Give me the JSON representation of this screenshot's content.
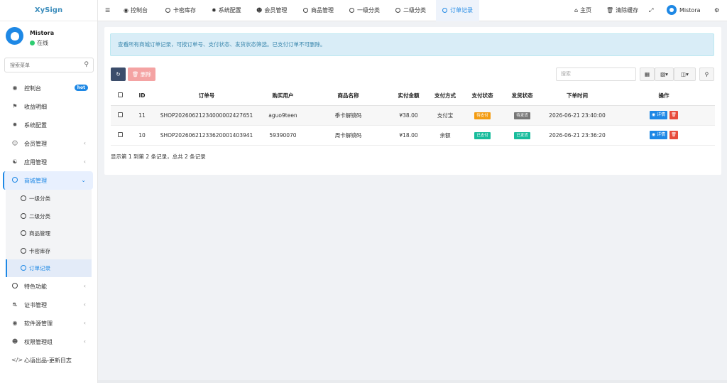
{
  "app": {
    "logo": "XySign"
  },
  "user": {
    "name": "Mistora",
    "status": "在线"
  },
  "sidebar": {
    "search_placeholder": "搜索菜单",
    "items": [
      {
        "label": "控制台",
        "icon": "dashboard-icon",
        "badge": "hot"
      },
      {
        "label": "收益明细",
        "icon": "flag-icon"
      },
      {
        "label": "系统配置",
        "icon": "gear-icon"
      },
      {
        "label": "会员管理",
        "icon": "user-circle-icon"
      },
      {
        "label": "应用管理",
        "icon": "cart-icon"
      },
      {
        "label": "商城管理",
        "icon": "circle-icon",
        "expanded": true
      },
      {
        "label": "特色功能",
        "icon": "circle-icon"
      },
      {
        "label": "证书管理",
        "icon": "car-icon"
      },
      {
        "label": "软件源管理",
        "icon": "dashboard-icon"
      },
      {
        "label": "权限管理组",
        "icon": "group-icon"
      },
      {
        "label": "心语出品-更新日志",
        "icon": "code-icon"
      }
    ],
    "sub_items": [
      {
        "label": "一级分类"
      },
      {
        "label": "二级分类"
      },
      {
        "label": "商品管理"
      },
      {
        "label": "卡密库存"
      },
      {
        "label": "订单记录",
        "active": true
      }
    ]
  },
  "topbar": {
    "tabs": [
      {
        "label": "控制台",
        "icon": "dashboard-icon"
      },
      {
        "label": "卡密库存",
        "icon": "circle-icon"
      },
      {
        "label": "系统配置",
        "icon": "gear-icon"
      },
      {
        "label": "会员管理",
        "icon": "group-icon"
      },
      {
        "label": "商品管理",
        "icon": "circle-icon"
      },
      {
        "label": "一级分类",
        "icon": "circle-icon"
      },
      {
        "label": "二级分类",
        "icon": "circle-icon"
      },
      {
        "label": "订单记录",
        "icon": "circle-icon",
        "active": true
      }
    ],
    "home": "主页",
    "clear_cache": "清除缓存",
    "user": "Mistora"
  },
  "main": {
    "notice": "查看所有商城订单记录，可按订单号、支付状态、发货状态筛选。已支付订单不可删除。",
    "delete_label": "删除",
    "search_placeholder": "搜索",
    "columns": [
      "ID",
      "订单号",
      "购买用户",
      "商品名称",
      "实付金额",
      "支付方式",
      "支付状态",
      "发货状态",
      "下单时间",
      "操作"
    ],
    "rows": [
      {
        "id": "11",
        "order_no": "SHOP20260621234000002427651",
        "user": "aguo9teen",
        "product": "季卡解锁码",
        "amount": "¥38.00",
        "pay_method": "支付宝",
        "pay_status": "待支付",
        "ship_status": "待发货",
        "time": "2026-06-21 23:40:00",
        "detail": "详情"
      },
      {
        "id": "10",
        "order_no": "SHOP20260621233620001403941",
        "user": "59390070",
        "product": "周卡解锁码",
        "amount": "¥18.00",
        "pay_method": "余额",
        "pay_status": "已支付",
        "ship_status": "已发货",
        "time": "2026-06-21 23:36:20",
        "detail": "详情"
      }
    ],
    "summary": "显示第 1 到第 2 条记录，总共 2 条记录"
  },
  "colors": {
    "accent": "#1e88e5",
    "pending": "#f39c12",
    "gray": "#777777",
    "success": "#18bc9c",
    "danger": "#e74c3c"
  }
}
